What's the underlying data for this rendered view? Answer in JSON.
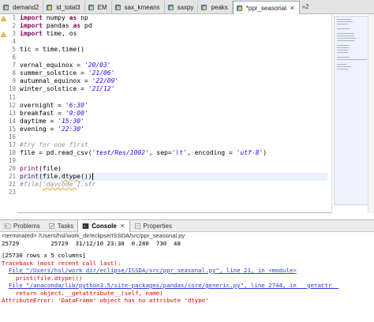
{
  "editor_tabs": [
    {
      "label": "demand2",
      "active": false
    },
    {
      "label": "id_total3",
      "active": false
    },
    {
      "label": "EM",
      "active": false
    },
    {
      "label": "sax_kmeans",
      "active": false
    },
    {
      "label": "saxpy",
      "active": false
    },
    {
      "label": "peaks",
      "active": false
    },
    {
      "label": "*ppr_seasonal",
      "active": true
    }
  ],
  "tab_overflow": "»2",
  "code_lines": [
    {
      "n": "1",
      "warn": true
    },
    {
      "n": "2",
      "warn": false
    },
    {
      "n": "3",
      "warn": true
    },
    {
      "n": "4"
    },
    {
      "n": "5"
    },
    {
      "n": "6"
    },
    {
      "n": "7"
    },
    {
      "n": "8"
    },
    {
      "n": "9"
    },
    {
      "n": "10"
    },
    {
      "n": "11"
    },
    {
      "n": "12"
    },
    {
      "n": "13"
    },
    {
      "n": "14"
    },
    {
      "n": "15"
    },
    {
      "n": "16"
    },
    {
      "n": "17"
    },
    {
      "n": "18"
    },
    {
      "n": "19"
    },
    {
      "n": "20"
    },
    {
      "n": "21"
    },
    {
      "n": "22"
    },
    {
      "n": "23"
    }
  ],
  "code": {
    "l1_kw": "import",
    "l1_mod": " numpy ",
    "l1_as": "as",
    "l1_alias": " np",
    "l2_kw": "import",
    "l2_mod": " pandas ",
    "l2_as": "as",
    "l2_alias": " pd",
    "l3_kw": "import",
    "l3_rest": " time, os",
    "l5": "tic = time.time()",
    "l7_var": "vernal_equinox = ",
    "l7_val": "'20/03'",
    "l8_var": "summer_solstice = ",
    "l8_val": "'21/06'",
    "l9_var": "autumnal_equinox = ",
    "l9_val": "'22/09'",
    "l10_var": "winter_solstice = ",
    "l10_val": "'21/12'",
    "l12_var": "overnight = ",
    "l12_val": "'6:30'",
    "l13_var": "breakfast = ",
    "l13_val": "'9:00'",
    "l14_var": "daytime = ",
    "l14_val": "'15:30'",
    "l15_var": "evening = ",
    "l15_val": "'22:30'",
    "l17": "#try for one first",
    "l18_a": "file = pd.read_csv(",
    "l18_s1": "'test/Res/1002'",
    "l18_b": ", sep=",
    "l18_s2": "'\\t'",
    "l18_c": ", encoding = ",
    "l18_s3": "'utf-8'",
    "l18_d": ")",
    "l20_fn": "print",
    "l20_rest": "(file)",
    "l21_fn": "print",
    "l21_a": "(file.",
    "l21_attr": "dtype",
    "l21_b": "())",
    "l22_a": "#file[",
    "l22_sq": "'davcode'",
    "l22_b": "].str"
  },
  "panel_tabs": [
    {
      "label": "Problems",
      "icon": "problems-icon",
      "active": false
    },
    {
      "label": "Tasks",
      "icon": "tasks-icon",
      "active": false
    },
    {
      "label": "Console",
      "icon": "console-icon",
      "active": true
    },
    {
      "label": "Properties",
      "icon": "properties-icon",
      "active": false
    }
  ],
  "console": {
    "terminated": "<terminated> /Users/hsl/work_dir/eclipse/ISSDA/src/ppr_seasonal.py",
    "row_out": "25729         25729  31/12/10 23:30  0.280  730  48",
    "rows_summary": "[25730 rows x 5 columns]",
    "traceback": "Traceback (most recent call last):",
    "frame1_link": "File \"/Users/hsl/work_dir/eclipse/ISSDA/src/ppr_seasonal.py\", line 21, in <module>",
    "frame1_code": "print(file.dtype())",
    "frame2_link": "File \"/anaconda/lib/python3.5/site-packages/pandas/core/generic.py\", line 2744, in __getattr__",
    "frame2_code": "return object.__getattribute__(self, name)",
    "error": "AttributeError: 'DataFrame' object has no attribute 'dtype'"
  },
  "colors": {
    "keyword": "#7f0055",
    "string": "#2a00ff",
    "comment": "#8f8f8f",
    "error": "#d00000",
    "link": "#2a3bd6"
  }
}
